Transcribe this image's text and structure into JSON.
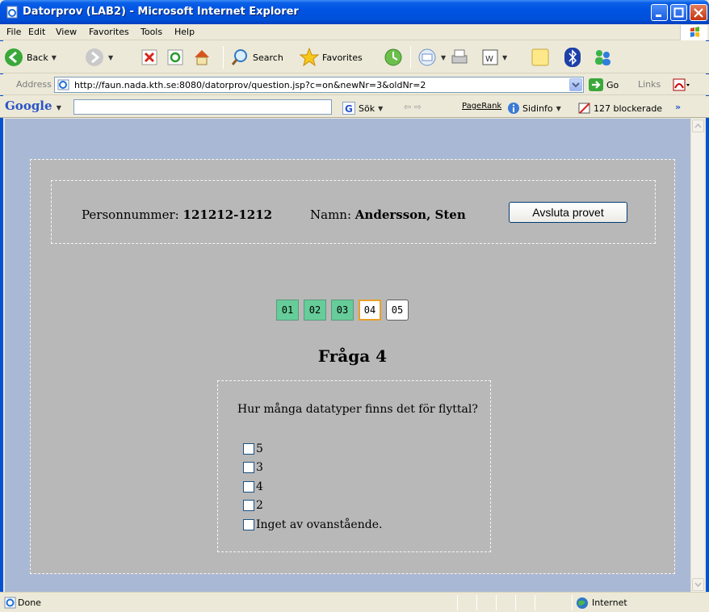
{
  "window": {
    "title": "Datorprov (LAB2) - Microsoft Internet Explorer"
  },
  "menu": [
    "File",
    "Edit",
    "View",
    "Favorites",
    "Tools",
    "Help"
  ],
  "toolbar": {
    "back_label": "Back",
    "search_label": "Search",
    "favorites_label": "Favorites"
  },
  "address": {
    "label": "Address",
    "url": "http://faun.nada.kth.se:8080/datorprov/question.jsp?c=on&newNr=3&oldNr=2",
    "go_label": "Go",
    "links_label": "Links"
  },
  "googlebar": {
    "logo": "Google",
    "search_label": "Sök",
    "pagerank_label": "PageRank",
    "sidinfo_label": "Sidinfo",
    "blocked_label": "127 blockerade",
    "more": "»"
  },
  "page": {
    "personnummer_label": "Personnummer:",
    "personnummer_value": "121212-1212",
    "name_label": "Namn:",
    "name_value": "Andersson, Sten",
    "end_button": "Avsluta provet",
    "question_nav": [
      {
        "label": "01",
        "state": "answered"
      },
      {
        "label": "02",
        "state": "answered"
      },
      {
        "label": "03",
        "state": "answered"
      },
      {
        "label": "04",
        "state": "current"
      },
      {
        "label": "05",
        "state": "unanswered"
      }
    ],
    "question_title": "Fråga 4",
    "question_text": "Hur många datatyper finns det för flyttal?",
    "options": [
      "5",
      "3",
      "4",
      "2",
      "Inget av ovanstående."
    ]
  },
  "status": {
    "text": "Done",
    "zone": "Internet"
  },
  "colors": {
    "answered": "#66cc99",
    "current_border": "#e8a028",
    "page_bg": "#b8b8b8",
    "viewport_bg": "#a9b8d5",
    "titlebar": "#0054e3"
  }
}
